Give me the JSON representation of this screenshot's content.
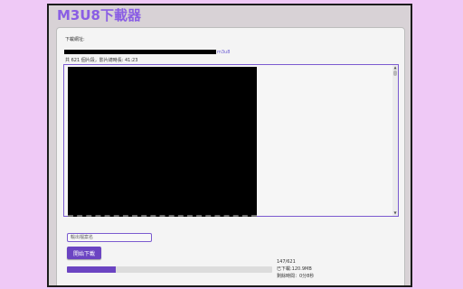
{
  "app": {
    "title": "M3U8下載器"
  },
  "url": {
    "label": "下載網址:",
    "redacted": true,
    "suffix": "m3u8"
  },
  "summary": {
    "text": "共 621 個片段，影片總時長: 41:23"
  },
  "log": {
    "redacted": true
  },
  "filename": {
    "placeholder": "輸出檔案名",
    "value": ""
  },
  "actions": {
    "start_label": "開始下載"
  },
  "progress": {
    "fraction": 0.2367,
    "count_text": "147/621",
    "downloaded_text": "已下載:120.9MB",
    "remaining_text": "剩餘時間：0分8秒"
  },
  "colors": {
    "page_background": "#efc9f6",
    "accent": "#6b44c2",
    "title": "#8a5ee4"
  }
}
